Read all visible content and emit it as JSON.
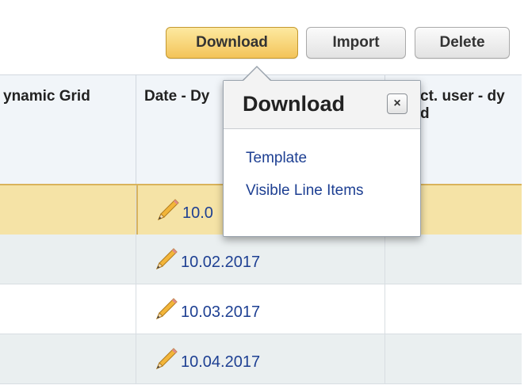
{
  "toolbar": {
    "download_label": "Download",
    "import_label": "Import",
    "delete_label": "Delete"
  },
  "grid": {
    "headers": [
      {
        "label": "ynamic Grid"
      },
      {
        "label": "Date - Dy"
      },
      {
        "label": "ct. user - dy",
        "line2": "d"
      }
    ],
    "rows": [
      {
        "date": "10.0"
      },
      {
        "date": "10.02.2017"
      },
      {
        "date": "10.03.2017"
      },
      {
        "date": "10.04.2017"
      }
    ]
  },
  "popover": {
    "title": "Download",
    "close_glyph": "×",
    "items": [
      "Template",
      "Visible Line Items"
    ]
  },
  "colors": {
    "primary_button": "#f3c45a",
    "selected_row": "#f5e3a6",
    "link": "#1d3f92",
    "alt_row": "#eaeff0"
  }
}
